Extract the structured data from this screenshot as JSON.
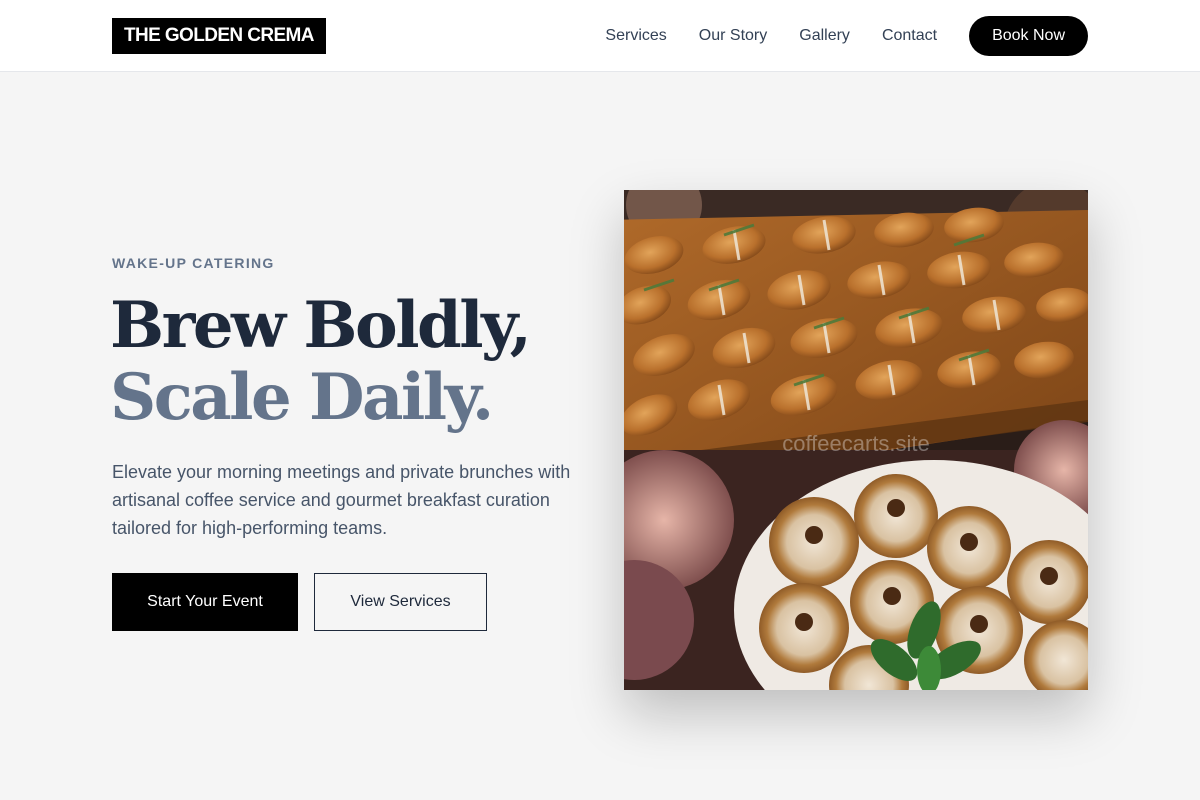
{
  "brand": {
    "name": "THE GOLDEN CREMA"
  },
  "nav": {
    "links": [
      "Services",
      "Our Story",
      "Gallery",
      "Contact"
    ],
    "cta": "Book Now"
  },
  "hero": {
    "eyebrow": "WAKE-UP CATERING",
    "headline_line1": "Brew Boldly,",
    "headline_line2": "Scale Daily.",
    "description": "Elevate your morning meetings and private brunches with artisanal coffee service and gourmet breakfast curation tailored for high-performing teams.",
    "primary_button": "Start Your Event",
    "secondary_button": "View Services",
    "image": {
      "subject": "catering-pastries-photo",
      "watermark": "coffeecarts.site"
    }
  },
  "colors": {
    "page_background": "#f5f5f5",
    "headline_dark": "#1e293b",
    "headline_muted": "#64748b",
    "button_black": "#000000"
  }
}
